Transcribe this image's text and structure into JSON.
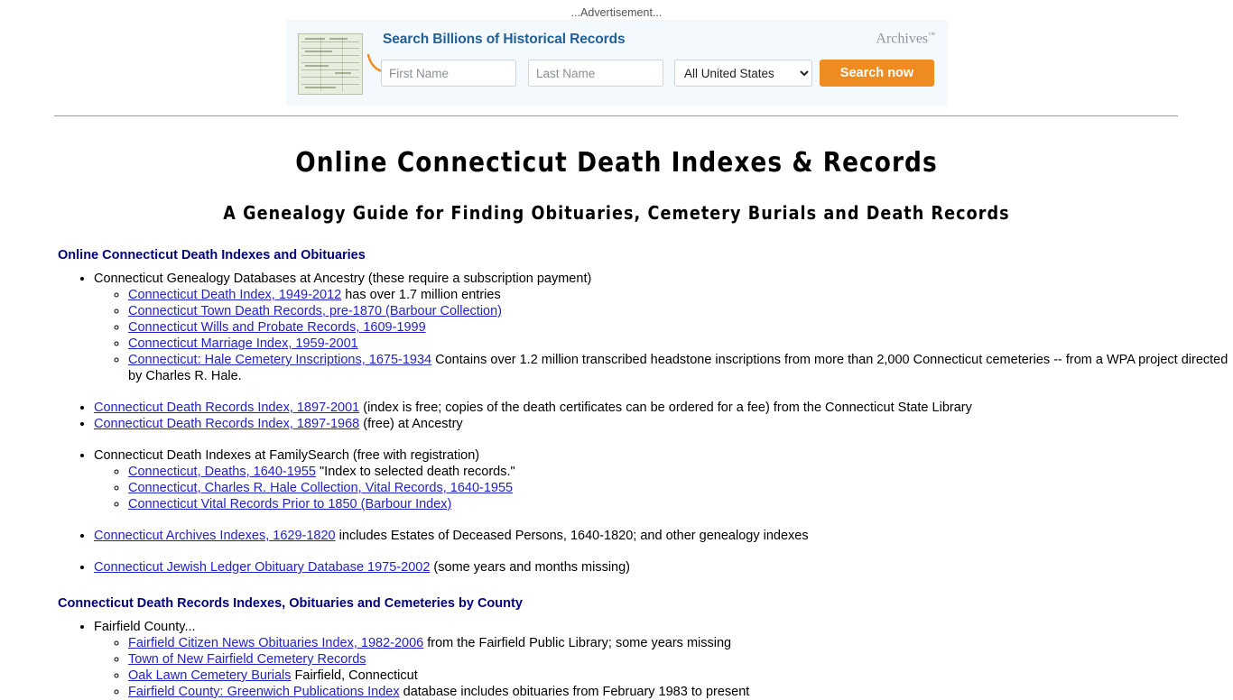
{
  "ad": {
    "label": "...Advertisement...",
    "headline": "Search Billions of Historical Records",
    "brand": "Archives",
    "brand_tm": "™",
    "first_name_placeholder": "First Name",
    "first_name_value": "",
    "last_name_placeholder": "Last Name",
    "last_name_value": "",
    "location_selected": "All United States",
    "location_options": [
      "All United States"
    ],
    "search_button": "Search now",
    "accent_color": "#ef8c21",
    "headline_color": "#1f6098",
    "panel_color": "#f4f9fd"
  },
  "page": {
    "title": "Online Connecticut Death Indexes & Records",
    "subtitle": "A Genealogy Guide for Finding Obituaries, Cemetery Burials and Death Records",
    "link_color": "#2222cc",
    "heading_color": "#000080"
  },
  "section1": {
    "heading": "Online Connecticut Death Indexes and Obituaries",
    "items": [
      {
        "text": "Connecticut Genealogy Databases at Ancestry (these require a subscription payment)",
        "link": null,
        "spaced": false,
        "children": [
          {
            "link": "Connecticut Death Index, 1949-2012",
            "text": " has over 1.7 million entries"
          },
          {
            "link": "Connecticut Town Death Records, pre-1870 (Barbour Collection)",
            "text": ""
          },
          {
            "link": "Connecticut Wills and Probate Records, 1609-1999",
            "text": ""
          },
          {
            "link": "Connecticut Marriage Index, 1959-2001",
            "text": ""
          },
          {
            "link": "Connecticut: Hale Cemetery Inscriptions, 1675-1934",
            "text": " Contains over 1.2 million transcribed headstone inscriptions from more than 2,000 Connecticut cemeteries -- from a WPA project directed by Charles R. Hale."
          }
        ]
      },
      {
        "link": "Connecticut Death Records Index, 1897-2001",
        "text": " (index is free; copies of the death certificates can be ordered for a fee) from the Connecticut State Library",
        "spaced": true,
        "children": []
      },
      {
        "link": "Connecticut Death Records Index, 1897-1968",
        "text": " (free) at Ancestry",
        "spaced": false,
        "children": []
      },
      {
        "text": "Connecticut Death Indexes at FamilySearch (free with registration)",
        "link": null,
        "spaced": true,
        "children": [
          {
            "link": "Connecticut, Deaths, 1640-1955",
            "text": " \"Index to selected death records.\""
          },
          {
            "link": "Connecticut, Charles R. Hale Collection, Vital Records, 1640-1955",
            "text": ""
          },
          {
            "link": "Connecticut Vital Records Prior to 1850 (Barbour Index)",
            "text": ""
          }
        ]
      },
      {
        "link": "Connecticut Archives Indexes, 1629-1820",
        "text": " includes Estates of Deceased Persons, 1640-1820; and other genealogy indexes",
        "spaced": true,
        "children": []
      },
      {
        "link": "Connecticut Jewish Ledger Obituary Database 1975-2002",
        "text": " (some years and months missing)",
        "spaced": true,
        "children": []
      }
    ]
  },
  "section2": {
    "heading": "Connecticut Death Records Indexes, Obituaries and Cemeteries by County",
    "items": [
      {
        "text": "Fairfield County...",
        "link": null,
        "spaced": false,
        "children": [
          {
            "link": "Fairfield Citizen News Obituaries Index, 1982-2006",
            "text": " from the Fairfield Public Library; some years missing"
          },
          {
            "link": "Town of New Fairfield Cemetery Records",
            "text": ""
          },
          {
            "link": "Oak Lawn Cemetery Burials",
            "text": " Fairfield, Connecticut"
          },
          {
            "link": "Fairfield County: Greenwich Publications Index",
            "text": " database includes obituaries from February 1983 to present"
          }
        ]
      }
    ]
  }
}
